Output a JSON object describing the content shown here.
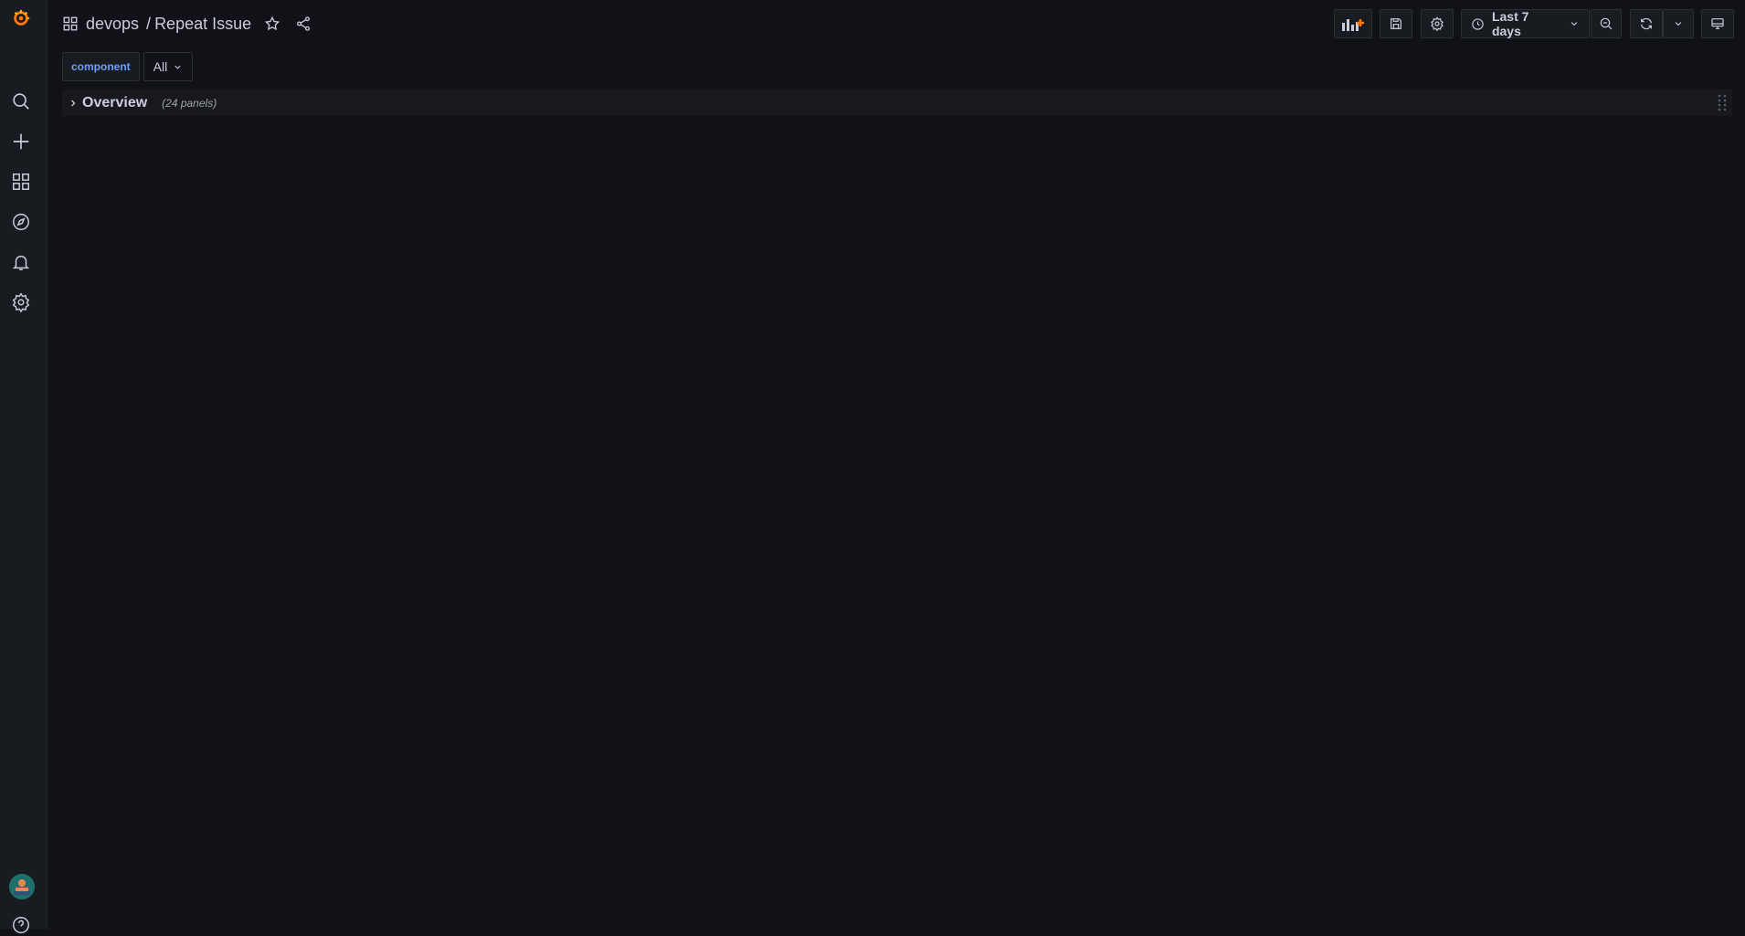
{
  "sidebar": {
    "logo": "grafana-logo-icon",
    "items": [
      {
        "icon": "search-icon"
      },
      {
        "icon": "plus-icon"
      },
      {
        "icon": "dashboards-icon"
      },
      {
        "icon": "explore-icon"
      },
      {
        "icon": "alerting-bell-icon"
      },
      {
        "icon": "gear-icon"
      }
    ],
    "bottom": [
      {
        "icon": "avatar"
      },
      {
        "icon": "help-icon"
      }
    ]
  },
  "header": {
    "folder": "devops",
    "separator": "/",
    "dashboard_title": "Repeat Issue",
    "time_range_label": "Last 7 days"
  },
  "variables": [
    {
      "label": "component",
      "value": "All"
    }
  ],
  "rows": [
    {
      "title": "Overview",
      "panel_count": "(24 panels)"
    }
  ],
  "colors": {
    "background": "#111217",
    "sidebar": "#181b1f",
    "accent_orange": "#ff780a",
    "variable_label": "#6e9fff"
  }
}
